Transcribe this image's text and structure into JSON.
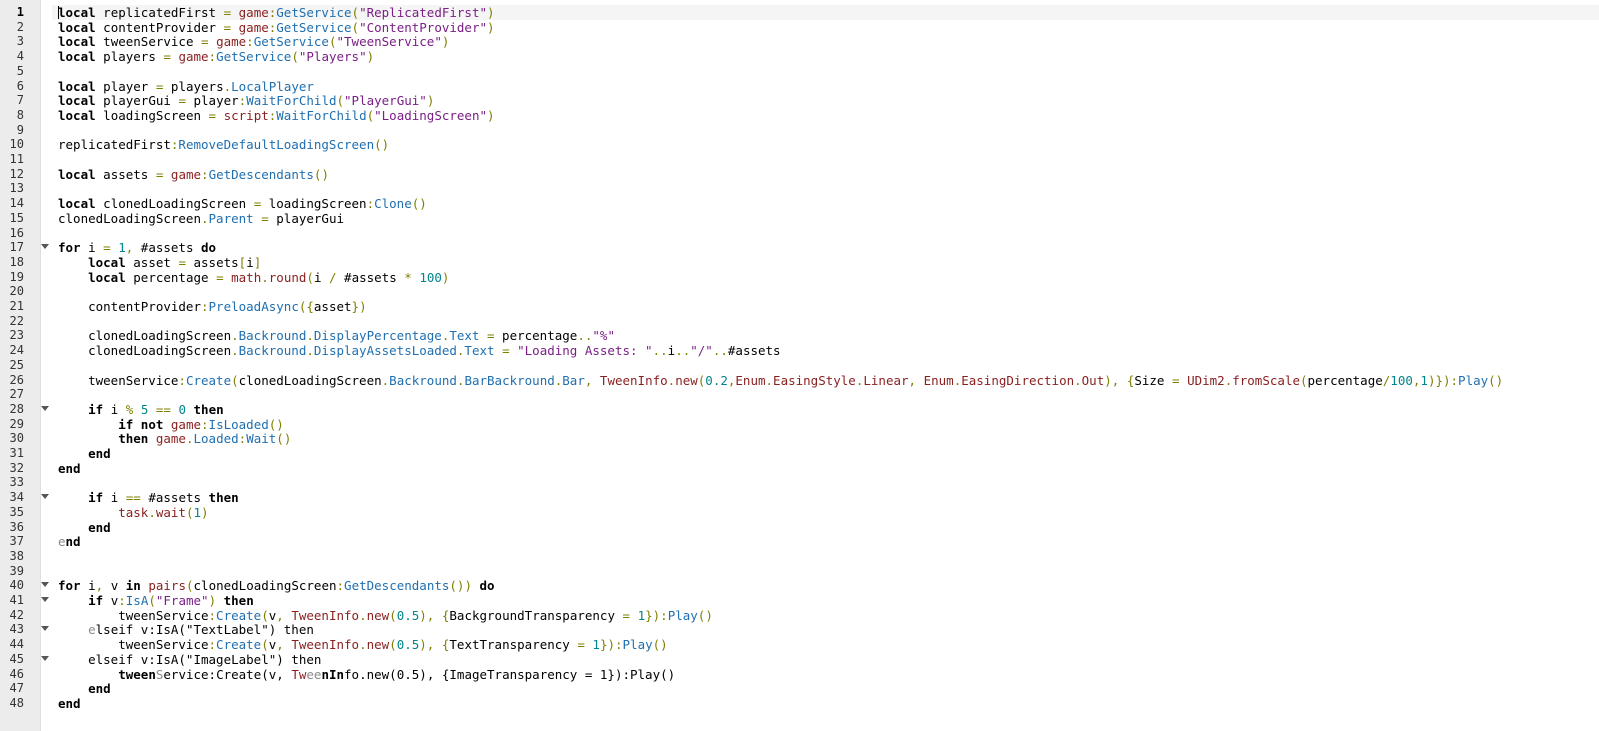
{
  "editor": {
    "current_line": 1,
    "colors": {
      "keyword": "#000000",
      "global": "#8a1f1f",
      "method": "#1f6fb0",
      "string": "#7a1f86",
      "number": "#00868b",
      "operator": "#7f7f00",
      "gutter_bg": "#ececec"
    },
    "fold_lines": [
      17,
      28,
      34,
      40,
      41,
      43,
      45
    ],
    "lines": [
      [
        [
          "kw",
          "local"
        ],
        [
          "id",
          " replicatedFirst "
        ],
        [
          "op",
          "="
        ],
        [
          "id",
          " "
        ],
        [
          "gl",
          "game"
        ],
        [
          "op",
          ":"
        ],
        [
          "mt",
          "GetService"
        ],
        [
          "op",
          "("
        ],
        [
          "st",
          "\"ReplicatedFirst\""
        ],
        [
          "op",
          ")"
        ]
      ],
      [
        [
          "kw",
          "local"
        ],
        [
          "id",
          " contentProvider "
        ],
        [
          "op",
          "="
        ],
        [
          "id",
          " "
        ],
        [
          "gl",
          "game"
        ],
        [
          "op",
          ":"
        ],
        [
          "mt",
          "GetService"
        ],
        [
          "op",
          "("
        ],
        [
          "st",
          "\"ContentProvider\""
        ],
        [
          "op",
          ")"
        ]
      ],
      [
        [
          "kw",
          "local"
        ],
        [
          "id",
          " tweenService "
        ],
        [
          "op",
          "="
        ],
        [
          "id",
          " "
        ],
        [
          "gl",
          "game"
        ],
        [
          "op",
          ":"
        ],
        [
          "mt",
          "GetService"
        ],
        [
          "op",
          "("
        ],
        [
          "st",
          "\"TweenService\""
        ],
        [
          "op",
          ")"
        ]
      ],
      [
        [
          "kw",
          "local"
        ],
        [
          "id",
          " players "
        ],
        [
          "op",
          "="
        ],
        [
          "id",
          " "
        ],
        [
          "gl",
          "game"
        ],
        [
          "op",
          ":"
        ],
        [
          "mt",
          "GetService"
        ],
        [
          "op",
          "("
        ],
        [
          "st",
          "\"Players\""
        ],
        [
          "op",
          ")"
        ]
      ],
      [],
      [
        [
          "kw",
          "local"
        ],
        [
          "id",
          " player "
        ],
        [
          "op",
          "="
        ],
        [
          "id",
          " players"
        ],
        [
          "op",
          "."
        ],
        [
          "mt",
          "LocalPlayer"
        ]
      ],
      [
        [
          "kw",
          "local"
        ],
        [
          "id",
          " playerGui "
        ],
        [
          "op",
          "="
        ],
        [
          "id",
          " player"
        ],
        [
          "op",
          ":"
        ],
        [
          "mt",
          "WaitForChild"
        ],
        [
          "op",
          "("
        ],
        [
          "st",
          "\"PlayerGui\""
        ],
        [
          "op",
          ")"
        ]
      ],
      [
        [
          "kw",
          "local"
        ],
        [
          "id",
          " loadingScreen "
        ],
        [
          "op",
          "="
        ],
        [
          "id",
          " "
        ],
        [
          "gl",
          "script"
        ],
        [
          "op",
          ":"
        ],
        [
          "mt",
          "WaitForChild"
        ],
        [
          "op",
          "("
        ],
        [
          "st",
          "\"LoadingScreen\""
        ],
        [
          "op",
          ")"
        ]
      ],
      [],
      [
        [
          "id",
          "replicatedFirst"
        ],
        [
          "op",
          ":"
        ],
        [
          "mt",
          "RemoveDefaultLoadingScreen"
        ],
        [
          "op",
          "()"
        ]
      ],
      [],
      [
        [
          "kw",
          "local"
        ],
        [
          "id",
          " assets "
        ],
        [
          "op",
          "="
        ],
        [
          "id",
          " "
        ],
        [
          "gl",
          "game"
        ],
        [
          "op",
          ":"
        ],
        [
          "mt",
          "GetDescendants"
        ],
        [
          "op",
          "()"
        ]
      ],
      [],
      [
        [
          "kw",
          "local"
        ],
        [
          "id",
          " clonedLoadingScreen "
        ],
        [
          "op",
          "="
        ],
        [
          "id",
          " loadingScreen"
        ],
        [
          "op",
          ":"
        ],
        [
          "mt",
          "Clone"
        ],
        [
          "op",
          "()"
        ]
      ],
      [
        [
          "id",
          "clonedLoadingScreen"
        ],
        [
          "op",
          "."
        ],
        [
          "mt",
          "Parent"
        ],
        [
          "id",
          " "
        ],
        [
          "op",
          "="
        ],
        [
          "id",
          " playerGui"
        ]
      ],
      [],
      [
        [
          "kw",
          "for"
        ],
        [
          "id",
          " i "
        ],
        [
          "op",
          "="
        ],
        [
          "id",
          " "
        ],
        [
          "nm",
          "1"
        ],
        [
          "op",
          ","
        ],
        [
          "id",
          " #assets "
        ],
        [
          "kw",
          "do"
        ]
      ],
      [
        [
          "id",
          "    "
        ],
        [
          "kw",
          "local"
        ],
        [
          "id",
          " asset "
        ],
        [
          "op",
          "="
        ],
        [
          "id",
          " assets"
        ],
        [
          "op",
          "["
        ],
        [
          "id",
          "i"
        ],
        [
          "op",
          "]"
        ]
      ],
      [
        [
          "id",
          "    "
        ],
        [
          "kw",
          "local"
        ],
        [
          "id",
          " percentage "
        ],
        [
          "op",
          "="
        ],
        [
          "id",
          " "
        ],
        [
          "gl",
          "math"
        ],
        [
          "op",
          "."
        ],
        [
          "gl",
          "round"
        ],
        [
          "op",
          "("
        ],
        [
          "id",
          "i "
        ],
        [
          "op",
          "/"
        ],
        [
          "id",
          " #assets "
        ],
        [
          "op",
          "*"
        ],
        [
          "id",
          " "
        ],
        [
          "nm",
          "100"
        ],
        [
          "op",
          ")"
        ]
      ],
      [],
      [
        [
          "id",
          "    contentProvider"
        ],
        [
          "op",
          ":"
        ],
        [
          "mt",
          "PreloadAsync"
        ],
        [
          "op",
          "({"
        ],
        [
          "id",
          "asset"
        ],
        [
          "op",
          "})"
        ]
      ],
      [],
      [
        [
          "id",
          "    clonedLoadingScreen"
        ],
        [
          "op",
          "."
        ],
        [
          "mt",
          "Backround"
        ],
        [
          "op",
          "."
        ],
        [
          "mt",
          "DisplayPercentage"
        ],
        [
          "op",
          "."
        ],
        [
          "mt",
          "Text"
        ],
        [
          "id",
          " "
        ],
        [
          "op",
          "="
        ],
        [
          "id",
          " percentage"
        ],
        [
          "op",
          ".."
        ],
        [
          "st",
          "\"%\""
        ]
      ],
      [
        [
          "id",
          "    clonedLoadingScreen"
        ],
        [
          "op",
          "."
        ],
        [
          "mt",
          "Backround"
        ],
        [
          "op",
          "."
        ],
        [
          "mt",
          "DisplayAssetsLoaded"
        ],
        [
          "op",
          "."
        ],
        [
          "mt",
          "Text"
        ],
        [
          "id",
          " "
        ],
        [
          "op",
          "="
        ],
        [
          "id",
          " "
        ],
        [
          "st",
          "\"Loading Assets: \""
        ],
        [
          "op",
          ".."
        ],
        [
          "id",
          "i"
        ],
        [
          "op",
          ".."
        ],
        [
          "st",
          "\"/\""
        ],
        [
          "op",
          ".."
        ],
        [
          "id",
          "#assets"
        ]
      ],
      [],
      [
        [
          "id",
          "    tweenService"
        ],
        [
          "op",
          ":"
        ],
        [
          "mt",
          "Create"
        ],
        [
          "op",
          "("
        ],
        [
          "id",
          "clonedLoadingScreen"
        ],
        [
          "op",
          "."
        ],
        [
          "mt",
          "Backround"
        ],
        [
          "op",
          "."
        ],
        [
          "mt",
          "BarBackround"
        ],
        [
          "op",
          "."
        ],
        [
          "mt",
          "Bar"
        ],
        [
          "op",
          ","
        ],
        [
          "id",
          " "
        ],
        [
          "gl",
          "TweenInfo"
        ],
        [
          "op",
          "."
        ],
        [
          "gl",
          "new"
        ],
        [
          "op",
          "("
        ],
        [
          "nm",
          "0.2"
        ],
        [
          "op",
          ","
        ],
        [
          "gl",
          "Enum"
        ],
        [
          "op",
          "."
        ],
        [
          "gl",
          "EasingStyle"
        ],
        [
          "op",
          "."
        ],
        [
          "gl",
          "Linear"
        ],
        [
          "op",
          ","
        ],
        [
          "id",
          " "
        ],
        [
          "gl",
          "Enum"
        ],
        [
          "op",
          "."
        ],
        [
          "gl",
          "EasingDirection"
        ],
        [
          "op",
          "."
        ],
        [
          "gl",
          "Out"
        ],
        [
          "op",
          "),"
        ],
        [
          "id",
          " "
        ],
        [
          "op",
          "{"
        ],
        [
          "id",
          "Size "
        ],
        [
          "op",
          "="
        ],
        [
          "id",
          " "
        ],
        [
          "gl",
          "UDim2"
        ],
        [
          "op",
          "."
        ],
        [
          "gl",
          "fromScale"
        ],
        [
          "op",
          "("
        ],
        [
          "id",
          "percentage"
        ],
        [
          "op",
          "/"
        ],
        [
          "nm",
          "100"
        ],
        [
          "op",
          ","
        ],
        [
          "nm",
          "1"
        ],
        [
          "op",
          ")})"
        ],
        [
          "op",
          ":"
        ],
        [
          "mt",
          "Play"
        ],
        [
          "op",
          "()"
        ]
      ],
      [],
      [
        [
          "id",
          "    "
        ],
        [
          "kw",
          "if"
        ],
        [
          "id",
          " i "
        ],
        [
          "op",
          "%"
        ],
        [
          "id",
          " "
        ],
        [
          "nm",
          "5"
        ],
        [
          "id",
          " "
        ],
        [
          "op",
          "=="
        ],
        [
          "id",
          " "
        ],
        [
          "nm",
          "0"
        ],
        [
          "id",
          " "
        ],
        [
          "kw",
          "then"
        ]
      ],
      [
        [
          "id",
          "        "
        ],
        [
          "kw",
          "if not"
        ],
        [
          "id",
          " "
        ],
        [
          "gl",
          "game"
        ],
        [
          "op",
          ":"
        ],
        [
          "mt",
          "IsLoaded"
        ],
        [
          "op",
          "()"
        ]
      ],
      [
        [
          "id",
          "        "
        ],
        [
          "kw",
          "then"
        ],
        [
          "id",
          " "
        ],
        [
          "gl",
          "game"
        ],
        [
          "op",
          "."
        ],
        [
          "mt",
          "Loaded"
        ],
        [
          "op",
          ":"
        ],
        [
          "mt",
          "Wait"
        ],
        [
          "op",
          "()"
        ]
      ],
      [
        [
          "id",
          "    "
        ],
        [
          "kw",
          "end"
        ]
      ],
      [
        [
          "kw",
          "end"
        ]
      ],
      [],
      [
        [
          "id",
          "    "
        ],
        [
          "kw",
          "if"
        ],
        [
          "id",
          " i "
        ],
        [
          "op",
          "=="
        ],
        [
          "id",
          " #assets "
        ],
        [
          "kw",
          "then"
        ]
      ],
      [
        [
          "id",
          "        "
        ],
        [
          "gl",
          "task"
        ],
        [
          "op",
          "."
        ],
        [
          "gl",
          "wait"
        ],
        [
          "op",
          "("
        ],
        [
          "nm",
          "1"
        ],
        [
          "op",
          ")"
        ]
      ],
      [
        [
          "id",
          "    "
        ],
        [
          "kw",
          "end"
        ]
      ],
      [
        [
          "dim",
          "e"
        ],
        [
          "kw",
          "nd"
        ]
      ],
      [],
      [],
      [
        [
          "kw",
          "for"
        ],
        [
          "id",
          " i"
        ],
        [
          "op",
          ","
        ],
        [
          "id",
          " v "
        ],
        [
          "kw",
          "in"
        ],
        [
          "id",
          " "
        ],
        [
          "gl",
          "pairs"
        ],
        [
          "op",
          "("
        ],
        [
          "id",
          "clonedLoadingScreen"
        ],
        [
          "op",
          ":"
        ],
        [
          "mt",
          "GetDescendants"
        ],
        [
          "op",
          "())"
        ],
        [
          "id",
          " "
        ],
        [
          "kw",
          "do"
        ]
      ],
      [
        [
          "id",
          "    "
        ],
        [
          "kw",
          "if"
        ],
        [
          "id",
          " v"
        ],
        [
          "op",
          ":"
        ],
        [
          "mt",
          "IsA"
        ],
        [
          "op",
          "("
        ],
        [
          "st",
          "\"Frame\""
        ],
        [
          "op",
          ")"
        ],
        [
          "id",
          " "
        ],
        [
          "kw",
          "then"
        ]
      ],
      [
        [
          "id",
          "        tweenService"
        ],
        [
          "op",
          ":"
        ],
        [
          "mt",
          "Create"
        ],
        [
          "op",
          "("
        ],
        [
          "id",
          "v"
        ],
        [
          "op",
          ","
        ],
        [
          "id",
          " "
        ],
        [
          "gl",
          "TweenInfo"
        ],
        [
          "op",
          "."
        ],
        [
          "gl",
          "new"
        ],
        [
          "op",
          "("
        ],
        [
          "nm",
          "0.5"
        ],
        [
          "op",
          "),"
        ],
        [
          "id",
          " "
        ],
        [
          "op",
          "{"
        ],
        [
          "id",
          "BackgroundTransparency "
        ],
        [
          "op",
          "="
        ],
        [
          "id",
          " "
        ],
        [
          "nm",
          "1"
        ],
        [
          "op",
          "})"
        ],
        [
          "op",
          ":"
        ],
        [
          "mt",
          "Play"
        ],
        [
          "op",
          "()"
        ]
      ],
      [
        [
          "id",
          "    "
        ],
        [
          "dim",
          "e"
        ],
        [
          "id",
          "lseif v:IsA(\"TextLabel\") then"
        ]
      ],
      [
        [
          "id",
          "        tweenService"
        ],
        [
          "op",
          ":"
        ],
        [
          "mt",
          "Create"
        ],
        [
          "op",
          "("
        ],
        [
          "id",
          "v"
        ],
        [
          "op",
          ","
        ],
        [
          "id",
          " "
        ],
        [
          "gl",
          "TweenInfo"
        ],
        [
          "op",
          "."
        ],
        [
          "gl",
          "new"
        ],
        [
          "op",
          "("
        ],
        [
          "nm",
          "0.5"
        ],
        [
          "op",
          "),"
        ],
        [
          "id",
          " "
        ],
        [
          "op",
          "{"
        ],
        [
          "id",
          "TextTransparency "
        ],
        [
          "op",
          "="
        ],
        [
          "id",
          " "
        ],
        [
          "nm",
          "1"
        ],
        [
          "op",
          "})"
        ],
        [
          "op",
          ":"
        ],
        [
          "mt",
          "Play"
        ],
        [
          "op",
          "()"
        ]
      ],
      [
        [
          "id",
          "    elseif v:IsA(\"ImageLabel\") then"
        ]
      ],
      [
        [
          "id",
          "        "
        ],
        [
          "kw",
          "tween"
        ],
        [
          "dim",
          "S"
        ],
        [
          "id",
          "ervice:Create(v, "
        ],
        [
          "gl",
          "Tw"
        ],
        [
          "dim",
          "ee"
        ],
        [
          "kw",
          "nIn"
        ],
        [
          "id",
          "fo.new(0.5), {ImageTransparency = 1}):Play()"
        ]
      ],
      [
        [
          "id",
          "    "
        ],
        [
          "kw",
          "end"
        ]
      ],
      [
        [
          "kw",
          "end"
        ]
      ]
    ]
  }
}
